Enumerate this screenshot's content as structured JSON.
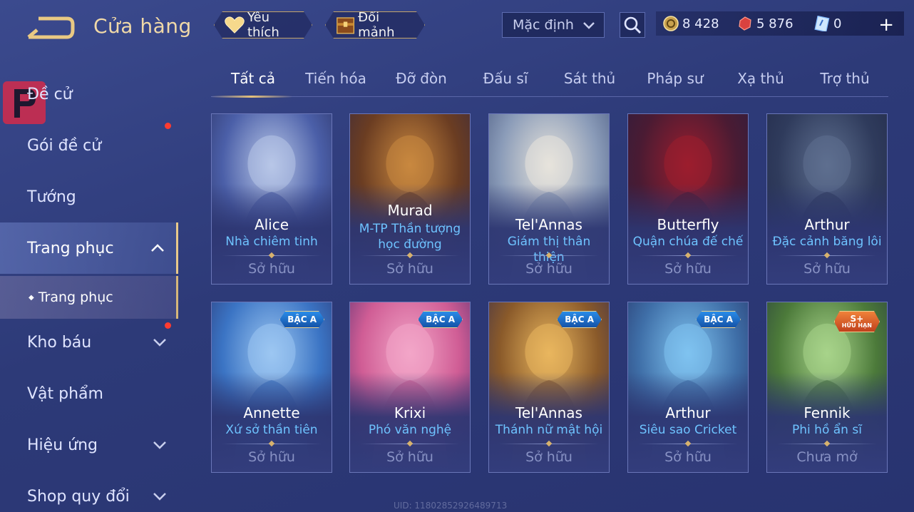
{
  "header": {
    "title": "Cửa hàng",
    "favorite_label": "Yêu thích",
    "exchange_label": "Đổi mảnh",
    "sort_value": "Mặc định"
  },
  "currency": {
    "gold": "8 428",
    "gems": "5 876",
    "vouchers": "0"
  },
  "sidebar": {
    "items": [
      {
        "label": "Đề cử"
      },
      {
        "label": "Gói đề cử"
      },
      {
        "label": "Tướng"
      },
      {
        "label": "Trang phục"
      },
      {
        "label": "Kho báu"
      },
      {
        "label": "Vật phẩm"
      },
      {
        "label": "Hiệu ứng"
      },
      {
        "label": "Shop quy đổi"
      }
    ],
    "subitem": "Trang phục"
  },
  "tabs": [
    "Tất cả",
    "Tiến hóa",
    "Đỡ đòn",
    "Đấu sĩ",
    "Sát thủ",
    "Pháp sư",
    "Xạ thủ",
    "Trợ thủ"
  ],
  "cards": [
    {
      "name": "Alice",
      "skin": "Nhà chiêm tinh",
      "status": "Sở hữu",
      "badge": ""
    },
    {
      "name": "Murad",
      "skin": "M-TP Thần tượng học đường",
      "status": "Sở hữu",
      "badge": ""
    },
    {
      "name": "Tel'Annas",
      "skin": "Giám thị thân thiện",
      "status": "Sở hữu",
      "badge": ""
    },
    {
      "name": "Butterfly",
      "skin": "Quận chúa đế chế",
      "status": "Sở hữu",
      "badge": ""
    },
    {
      "name": "Arthur",
      "skin": "Đặc cảnh băng lôi",
      "status": "Sở hữu",
      "badge": ""
    },
    {
      "name": "Annette",
      "skin": "Xứ sở thần tiên",
      "status": "Sở hữu",
      "badge": "BẬC A"
    },
    {
      "name": "Krixi",
      "skin": "Phó văn nghệ",
      "status": "Sở hữu",
      "badge": "BẬC A"
    },
    {
      "name": "Tel'Annas",
      "skin": "Thánh nữ mật hội",
      "status": "Sở hữu",
      "badge": "BẬC A"
    },
    {
      "name": "Arthur",
      "skin": "Siêu sao Cricket",
      "status": "Sở hữu",
      "badge": "BẬC A"
    },
    {
      "name": "Fennik",
      "skin": "Phi hồ ẩn sĩ",
      "status": "Chưa mở",
      "badge": "S+",
      "badge_sub": "HỮU HẠN"
    }
  ],
  "footer": {
    "uid": "UID: 11802852926489713"
  },
  "colors": {
    "accent_gold": "#e6c27a",
    "skin_blue": "#6ec3ff",
    "badge_blue": "#2a8ce8",
    "badge_orange": "#f0823a",
    "notify_red": "#ff3b30"
  }
}
